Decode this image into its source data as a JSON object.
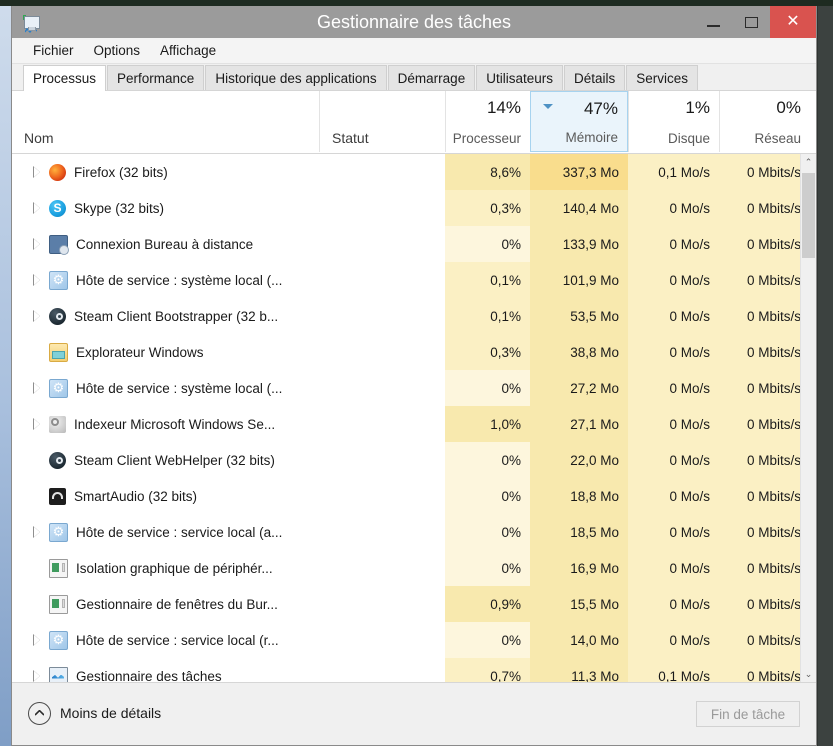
{
  "window": {
    "title": "Gestionnaire des tâches",
    "app_icon": "task-manager-icon",
    "buttons": {
      "minimize": "—",
      "maximize": "❐",
      "close": "✕"
    }
  },
  "menubar": {
    "items": [
      "Fichier",
      "Options",
      "Affichage"
    ]
  },
  "tabs": [
    {
      "label": "Processus",
      "active": true
    },
    {
      "label": "Performance",
      "active": false
    },
    {
      "label": "Historique des applications",
      "active": false
    },
    {
      "label": "Démarrage",
      "active": false
    },
    {
      "label": "Utilisateurs",
      "active": false
    },
    {
      "label": "Détails",
      "active": false
    },
    {
      "label": "Services",
      "active": false
    }
  ],
  "columns": [
    {
      "key": "name",
      "label": "Nom",
      "pct": "",
      "sorted": false
    },
    {
      "key": "status",
      "label": "Statut",
      "pct": "",
      "sorted": false
    },
    {
      "key": "cpu",
      "label": "Processeur",
      "pct": "14%",
      "sorted": false
    },
    {
      "key": "mem",
      "label": "Mémoire",
      "pct": "47%",
      "sorted": true
    },
    {
      "key": "disk",
      "label": "Disque",
      "pct": "1%",
      "sorted": false
    },
    {
      "key": "net",
      "label": "Réseau",
      "pct": "0%",
      "sorted": false
    }
  ],
  "sort": {
    "column": "mem",
    "direction": "descending"
  },
  "processes": [
    {
      "name": "Firefox (32 bits)",
      "icon": "firefox-icon",
      "expandable": true,
      "status": "",
      "cpu": "8,6%",
      "mem": "337,3 Mo",
      "disk": "0,1 Mo/s",
      "net": "0 Mbits/s",
      "cpu_heat": 3,
      "mem_heat": 4,
      "disk_heat": 2,
      "net_heat": 2
    },
    {
      "name": "Skype (32 bits)",
      "icon": "skype-icon",
      "expandable": true,
      "status": "",
      "cpu": "0,3%",
      "mem": "140,4 Mo",
      "disk": "0 Mo/s",
      "net": "0 Mbits/s",
      "cpu_heat": 2,
      "mem_heat": 3,
      "disk_heat": 2,
      "net_heat": 2
    },
    {
      "name": "Connexion Bureau à distance",
      "icon": "remote-desktop-icon",
      "expandable": true,
      "status": "",
      "cpu": "0%",
      "mem": "133,9 Mo",
      "disk": "0 Mo/s",
      "net": "0 Mbits/s",
      "cpu_heat": 1,
      "mem_heat": 3,
      "disk_heat": 2,
      "net_heat": 2
    },
    {
      "name": "Hôte de service : système local (...",
      "icon": "service-host-icon",
      "expandable": true,
      "status": "",
      "cpu": "0,1%",
      "mem": "101,9 Mo",
      "disk": "0 Mo/s",
      "net": "0 Mbits/s",
      "cpu_heat": 2,
      "mem_heat": 3,
      "disk_heat": 2,
      "net_heat": 2
    },
    {
      "name": "Steam Client Bootstrapper (32 b...",
      "icon": "steam-icon",
      "expandable": true,
      "status": "",
      "cpu": "0,1%",
      "mem": "53,5 Mo",
      "disk": "0 Mo/s",
      "net": "0 Mbits/s",
      "cpu_heat": 2,
      "mem_heat": 3,
      "disk_heat": 2,
      "net_heat": 2
    },
    {
      "name": "Explorateur Windows",
      "icon": "explorer-icon",
      "expandable": false,
      "status": "",
      "cpu": "0,3%",
      "mem": "38,8 Mo",
      "disk": "0 Mo/s",
      "net": "0 Mbits/s",
      "cpu_heat": 2,
      "mem_heat": 3,
      "disk_heat": 2,
      "net_heat": 2
    },
    {
      "name": "Hôte de service : système local (...",
      "icon": "service-host-icon",
      "expandable": true,
      "status": "",
      "cpu": "0%",
      "mem": "27,2 Mo",
      "disk": "0 Mo/s",
      "net": "0 Mbits/s",
      "cpu_heat": 1,
      "mem_heat": 3,
      "disk_heat": 2,
      "net_heat": 2
    },
    {
      "name": "Indexeur Microsoft Windows Se...",
      "icon": "search-indexer-icon",
      "expandable": true,
      "status": "",
      "cpu": "1,0%",
      "mem": "27,1 Mo",
      "disk": "0 Mo/s",
      "net": "0 Mbits/s",
      "cpu_heat": 3,
      "mem_heat": 3,
      "disk_heat": 2,
      "net_heat": 2
    },
    {
      "name": "Steam Client WebHelper (32 bits)",
      "icon": "steam-icon",
      "expandable": false,
      "status": "",
      "cpu": "0%",
      "mem": "22,0 Mo",
      "disk": "0 Mo/s",
      "net": "0 Mbits/s",
      "cpu_heat": 1,
      "mem_heat": 3,
      "disk_heat": 2,
      "net_heat": 2
    },
    {
      "name": "SmartAudio (32 bits)",
      "icon": "smartaudio-icon",
      "expandable": false,
      "status": "",
      "cpu": "0%",
      "mem": "18,8 Mo",
      "disk": "0 Mo/s",
      "net": "0 Mbits/s",
      "cpu_heat": 1,
      "mem_heat": 3,
      "disk_heat": 2,
      "net_heat": 2
    },
    {
      "name": "Hôte de service : service local (a...",
      "icon": "service-host-icon",
      "expandable": true,
      "status": "",
      "cpu": "0%",
      "mem": "18,5 Mo",
      "disk": "0 Mo/s",
      "net": "0 Mbits/s",
      "cpu_heat": 1,
      "mem_heat": 3,
      "disk_heat": 2,
      "net_heat": 2
    },
    {
      "name": "Isolation graphique de périphér...",
      "icon": "window-icon",
      "expandable": false,
      "status": "",
      "cpu": "0%",
      "mem": "16,9 Mo",
      "disk": "0 Mo/s",
      "net": "0 Mbits/s",
      "cpu_heat": 1,
      "mem_heat": 3,
      "disk_heat": 2,
      "net_heat": 2
    },
    {
      "name": "Gestionnaire de fenêtres du Bur...",
      "icon": "window-icon",
      "expandable": false,
      "status": "",
      "cpu": "0,9%",
      "mem": "15,5 Mo",
      "disk": "0 Mo/s",
      "net": "0 Mbits/s",
      "cpu_heat": 3,
      "mem_heat": 3,
      "disk_heat": 2,
      "net_heat": 2
    },
    {
      "name": "Hôte de service : service local (r...",
      "icon": "service-host-icon",
      "expandable": true,
      "status": "",
      "cpu": "0%",
      "mem": "14,0 Mo",
      "disk": "0 Mo/s",
      "net": "0 Mbits/s",
      "cpu_heat": 1,
      "mem_heat": 3,
      "disk_heat": 2,
      "net_heat": 2
    },
    {
      "name": "Gestionnaire des tâches",
      "icon": "task-manager-icon",
      "expandable": true,
      "status": "",
      "cpu": "0,7%",
      "mem": "11,3 Mo",
      "disk": "0,1 Mo/s",
      "net": "0 Mbits/s",
      "cpu_heat": 2,
      "mem_heat": 3,
      "disk_heat": 2,
      "net_heat": 2
    }
  ],
  "scrollbar": {
    "up_arrow": "⌃",
    "down_arrow": "⌄"
  },
  "footer": {
    "less_details_label": "Moins de détails",
    "less_details_icon": "chevron-up-icon",
    "end_task_label": "Fin de tâche",
    "end_task_disabled": true
  },
  "colors": {
    "titlebar": "#9b9b9b",
    "close_button": "#d9534f",
    "sorted_header": "#eaf4fb",
    "sorted_border": "#a7d3ef",
    "heat_1": "#fdf6dd",
    "heat_2": "#fbf0c4",
    "heat_3": "#f8e9ae",
    "heat_4": "#f9dd8d"
  }
}
